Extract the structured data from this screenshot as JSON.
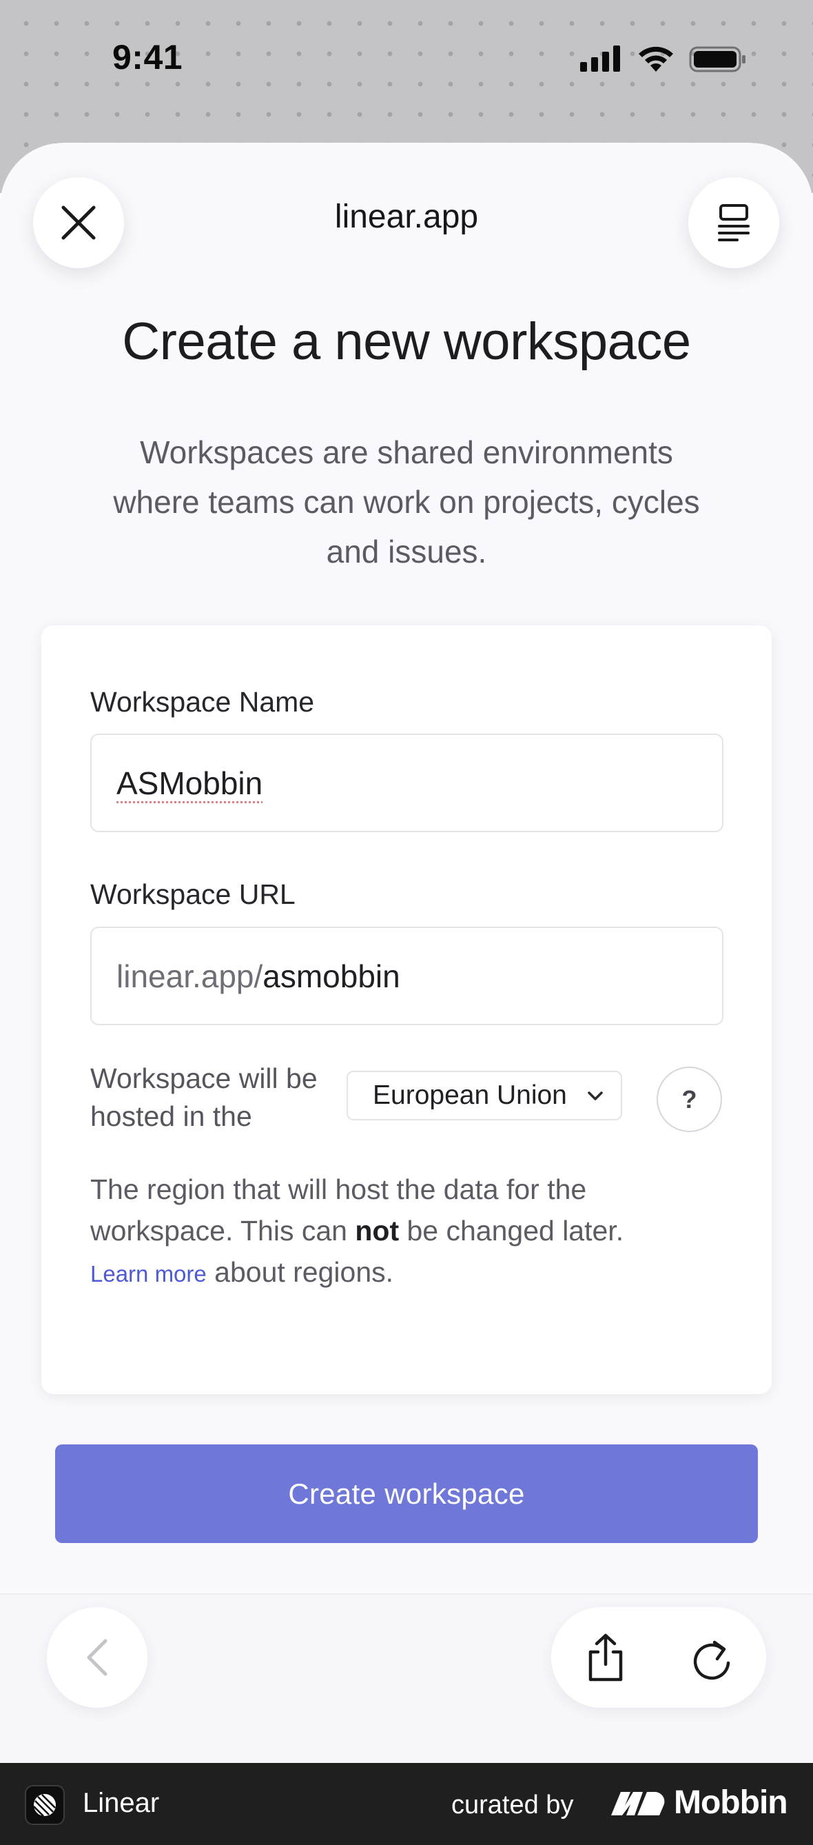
{
  "status_bar": {
    "time": "9:41",
    "icons": [
      "cellular-signal-icon",
      "wifi-icon",
      "battery-icon"
    ]
  },
  "browser": {
    "url_title": "linear.app",
    "close_icon": "close-icon",
    "reader_icon": "reader-mode-icon",
    "toolbar_icons": [
      "back-chevron-icon",
      "share-icon",
      "reload-icon"
    ]
  },
  "page": {
    "heading": "Create a new workspace",
    "intro": "Workspaces are shared environments where teams can work on projects, cycles and issues."
  },
  "form": {
    "name_label": "Workspace Name",
    "name_value": "ASMobbin",
    "url_label": "Workspace URL",
    "url_prefix": "linear.app/",
    "url_value": "asmobbin",
    "hosted_label": "Workspace will be hosted in the",
    "region_selected": "European Union",
    "help_label": "?",
    "note_before": "The region that will host the data for the workspace. This can ",
    "note_emphasis": "not",
    "note_middle": " be changed later. ",
    "note_link": "Learn more",
    "note_after": " about regions."
  },
  "actions": {
    "create_label": "Create workspace"
  },
  "footer": {
    "app_name": "Linear",
    "curated_by": "curated by",
    "brand": "Mobbin"
  },
  "colors": {
    "primary_button": "#6f78d8",
    "link": "#4d5ad1",
    "footer_bg": "#1f1f1f",
    "sheet_bg": "#f9f8fc"
  }
}
